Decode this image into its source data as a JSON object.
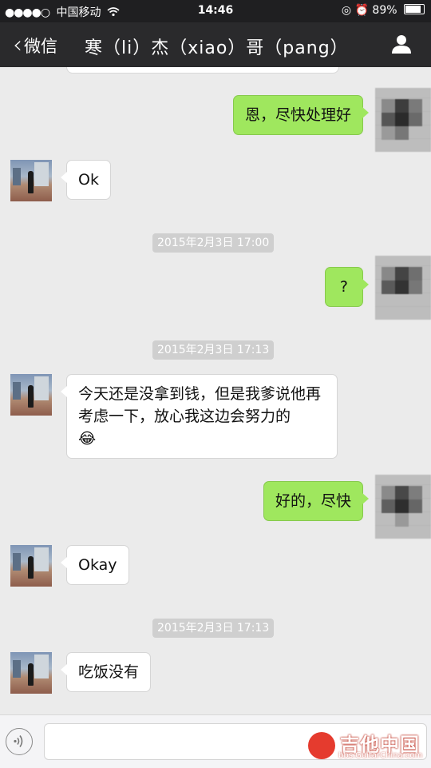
{
  "status_bar": {
    "signal": "●●●●○",
    "carrier": "中国移动",
    "wifi_icon": "wifi-icon",
    "time": "14:46",
    "battery": "89%"
  },
  "nav": {
    "back_label": "微信",
    "title": "寒（li）杰（xiao）哥（pang）",
    "profile_icon": "person-icon"
  },
  "messages": [
    {
      "from": "me",
      "text": "恩，尽快处理好"
    },
    {
      "from": "friend",
      "text": "Ok"
    },
    {
      "type": "timestamp",
      "text": "2015年2月3日 17:00"
    },
    {
      "from": "me",
      "text": "?"
    },
    {
      "type": "timestamp",
      "text": "2015年2月3日 17:13"
    },
    {
      "from": "friend",
      "text": "今天还是没拿到钱，但是我爹说他再考虑一下，放心我这边会努力的",
      "emoji": "😂"
    },
    {
      "from": "me",
      "text": "好的，尽快"
    },
    {
      "from": "friend",
      "text": "Okay"
    },
    {
      "type": "timestamp",
      "text": "2015年2月3日 17:13"
    },
    {
      "from": "friend",
      "text": "吃饭没有"
    }
  ],
  "input_bar": {
    "voice_icon": "voice-icon",
    "input_value": ""
  },
  "watermark": {
    "name": "吉他中国",
    "url": "bbs.GuitarChina.com"
  },
  "colors": {
    "sent_bubble": "#9fe75e",
    "received_bubble": "#ffffff",
    "nav_bg": "#2a2a2c",
    "chat_bg": "#ebebeb"
  }
}
